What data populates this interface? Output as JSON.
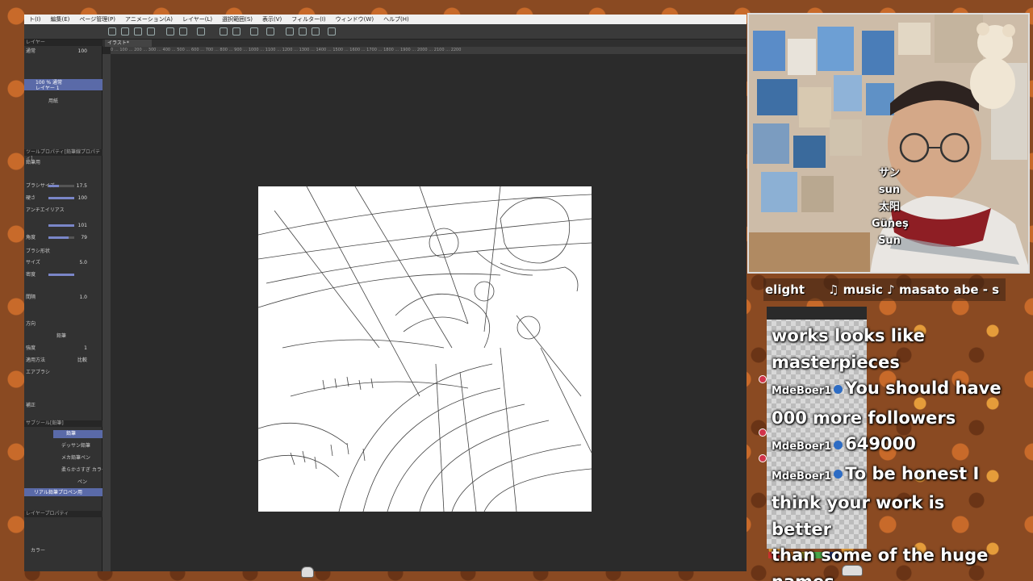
{
  "menu": [
    "ト(I)",
    "編集(E)",
    "ページ管理(P)",
    "アニメーション(A)",
    "レイヤー(L)",
    "選択範囲(S)",
    "表示(V)",
    "フィルター(I)",
    "ウィンドウ(W)",
    "ヘルプ(H)"
  ],
  "document_tab": "イラスト*",
  "ruler_text": "0 … 100 … 200 … 300 … 400 … 500 … 600 … 700 … 800 … 900 … 1000 … 1100 … 1200 … 1300 … 1400 … 1500 … 1600 … 1700 … 1800 … 1900 … 2000 … 2100 … 2200",
  "layer_panel": {
    "header": "レイヤー",
    "blend_mode": "通常",
    "opacity": "100",
    "layer_1_line1": "100 % 通常",
    "layer_1_line2": "レイヤー 1",
    "paper_layer": "用紙"
  },
  "tool_property": {
    "header": "ツールプロパティ[鉛筆線プロパティ]",
    "tool_name": "鉛筆用",
    "brush_size_label": "ブラシサイズ",
    "brush_size_value": "17.5",
    "hardness_label": "硬さ",
    "hardness_value": "100",
    "antialias_label": "アンチエイリアス",
    "density_value": "101",
    "angle_label": "角度",
    "angle_value": "79",
    "shape_label": "ブラシ形状",
    "size_label": "サイズ",
    "size_value": "5.0",
    "density_label": "密度",
    "interval_label": "間隔",
    "interval_value": "1.0",
    "direction_label": "方向",
    "pencil_label": "鉛筆",
    "texture_label": "強度",
    "texture_value": "1",
    "blend_method_label": "適用方法",
    "blend_method_value": "比較",
    "airbrush_label": "エアブラシ",
    "modifier_label": "補正"
  },
  "sub_tool": {
    "header": "サブツール[鉛筆]",
    "tab_pencil": "鉛筆",
    "items": [
      "デッサン鉛筆",
      "メカ鉛筆ペン",
      "柔らかさすぎ カラー",
      "ペン",
      "リアル鉛筆プロペン用"
    ]
  },
  "layer_property": {
    "header": "レイヤープロパティ",
    "color_label": "カラー"
  },
  "caption": [
    "サン",
    "sun",
    "太阳",
    "Güneş",
    "Sun"
  ],
  "ticker": {
    "left": "elight",
    "right": "♫ music ♪ masato abe - s"
  },
  "chat": {
    "line1": "works looks like",
    "line2": "masterpieces",
    "messages": [
      {
        "user": "MdeBoer1",
        "text": "You should have",
        "cont": "000 more followers"
      },
      {
        "user": "MdeBoer1",
        "text": "649000"
      },
      {
        "user": "MdeBoer1",
        "text": "To be honest I",
        "cont": "think your work is better",
        "cont2": "than some of the huge",
        "cont3": "names"
      }
    ]
  },
  "colors": {
    "accent": "#5a6aa8",
    "verified": "#2d6cc4",
    "mod": "#d2334a"
  },
  "swatch_colors": [
    "#c8322d",
    "#d97a2a",
    "#c9c22e",
    "#4aa64a",
    "#2f4fb3"
  ]
}
